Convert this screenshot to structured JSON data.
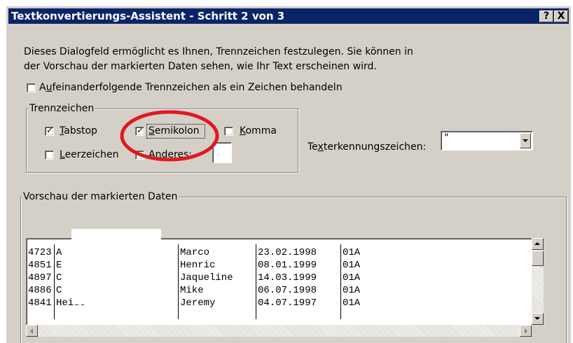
{
  "window": {
    "title": "Textkonvertierungs-Assistent - Schritt 2 von 3",
    "help_button": "?",
    "close_button": "X"
  },
  "description": {
    "line1": "Dieses Dialogfeld ermöglicht es Ihnen, Trennzeichen festzulegen. Sie können in",
    "line2": "der Vorschau der markierten Daten sehen, wie Ihr Text erscheinen wird."
  },
  "consecutive": {
    "label_before": "A",
    "label_ul": "u",
    "label_after": "feinanderfolgende Trennzeichen als ein Zeichen behandeln",
    "checked": false
  },
  "delimiters": {
    "group_label": "Trennzeichen",
    "tab": {
      "ul": "T",
      "rest": "abstop",
      "checked": true
    },
    "semicolon": {
      "ul": "S",
      "rest": "emikolon",
      "checked": true
    },
    "comma": {
      "ul": "K",
      "rest": "omma",
      "checked": false
    },
    "space": {
      "ul": "L",
      "rest": "eerzeichen",
      "checked": false
    },
    "other": {
      "ul": "A",
      "rest": "nderes:",
      "checked": false,
      "value": ""
    }
  },
  "text_qualifier": {
    "label_before": "Te",
    "label_ul": "x",
    "label_after": "terkennungszeichen:",
    "value": "\""
  },
  "preview": {
    "group_label": "Vorschau der markierten Daten",
    "rows": [
      [
        "4723",
        "A",
        "Marco",
        "23.02.1998",
        "01A"
      ],
      [
        "4851",
        "E",
        "Henric",
        "08.01.1999",
        "01A"
      ],
      [
        "4897",
        "C",
        "Jaqueline",
        "14.03.1999",
        "01A"
      ],
      [
        "4886",
        "C",
        "Mike",
        "06.07.1998",
        "01A"
      ],
      [
        "4841",
        "Heide",
        "Jeremy",
        "04.07.1997",
        "01A"
      ]
    ]
  },
  "colors": {
    "titlebar": "#0a246a",
    "dialog_bg": "#d4d0c8",
    "highlight_circle": "#e0191f"
  }
}
